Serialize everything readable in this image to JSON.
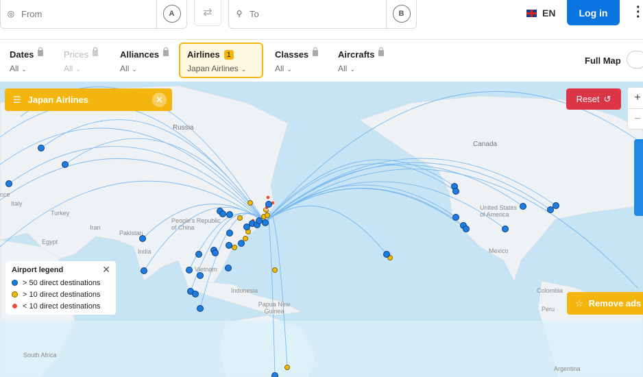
{
  "search": {
    "from_placeholder": "From",
    "to_placeholder": "To",
    "from_point_label": "A",
    "to_point_label": "B"
  },
  "header": {
    "language": "EN",
    "login_label": "Log in"
  },
  "filters": {
    "dates": {
      "label": "Dates",
      "value": "All"
    },
    "prices": {
      "label": "Prices",
      "value": "All"
    },
    "alliances": {
      "label": "Alliances",
      "value": "All"
    },
    "airlines": {
      "label": "Airlines",
      "badge": "1",
      "value": "Japan Airlines"
    },
    "classes": {
      "label": "Classes",
      "value": "All"
    },
    "aircrafts": {
      "label": "Aircrafts",
      "value": "All"
    },
    "full_map_label": "Full Map"
  },
  "map": {
    "selected_airline_chip": "Japan Airlines",
    "reset_label": "Reset",
    "remove_ads_label": "Remove ads",
    "labels": {
      "russia": "Russia",
      "canada": "Canada",
      "china": "People's Republic of China",
      "china_alt": "South",
      "usa": "United States of America",
      "mexico": "Mexico",
      "turkey": "Turkey",
      "iran": "Iran",
      "egypt": "Egypt",
      "pakistan": "Pakistan",
      "india": "India",
      "vietnam": "Vietnam",
      "indonesia": "Indonesia",
      "papua": "Papua New Guinea",
      "colombia": "Colombia",
      "peru": "Peru",
      "south_africa": "South Africa",
      "argentina": "Argentina",
      "italy": "Italy",
      "france": "nce"
    }
  },
  "legend": {
    "title": "Airport legend",
    "items": [
      {
        "label": "> 50 direct destinations",
        "color": "#1e7be0"
      },
      {
        "label": "> 10 direct destinations",
        "color": "#f0b90b"
      },
      {
        "label": "< 10 direct destinations",
        "color": "#e0553a"
      }
    ]
  },
  "colors": {
    "accent_blue": "#0a75e0",
    "accent_yellow": "#f5b50f",
    "reset_red": "#dc3545",
    "ocean": "#c7e4f4",
    "land": "#eef2f4",
    "route": "#5aa8ee"
  }
}
